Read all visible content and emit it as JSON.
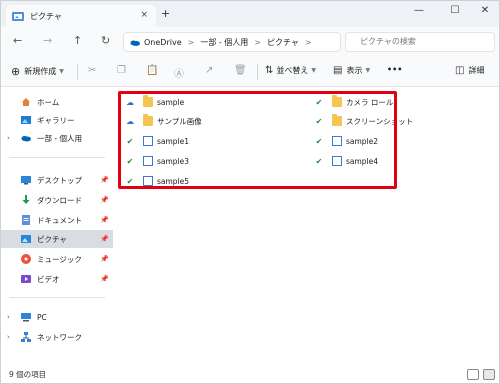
{
  "window": {
    "tab_title": "ピクチャ",
    "tab_close": "×",
    "new_tab": "+",
    "minimize": "—",
    "maximize": "☐",
    "close": "✕"
  },
  "nav": {
    "back": "←",
    "forward": "→",
    "up": "↑",
    "refresh": "↻"
  },
  "breadcrumb": [
    "OneDrive",
    ">",
    "一部 - 個人用",
    ">",
    "ピクチャ",
    ">"
  ],
  "search": {
    "placeholder": "ピクチャの検索"
  },
  "toolbar": {
    "new_label": "新規作成",
    "sort_label": "並べ替え",
    "view_label": "表示",
    "more_label": "•••",
    "details_label": "詳細"
  },
  "sidebar": {
    "items": [
      {
        "label": "ホーム"
      },
      {
        "label": "ギャラリー"
      },
      {
        "label": "一部 - 個人用"
      },
      {
        "label": "デスクトップ"
      },
      {
        "label": "ダウンロード"
      },
      {
        "label": "ドキュメント"
      },
      {
        "label": "ピクチャ"
      },
      {
        "label": "ミュージック"
      },
      {
        "label": "ビデオ"
      },
      {
        "label": "PC"
      },
      {
        "label": "ネットワーク"
      }
    ]
  },
  "files": [
    {
      "name": "sample",
      "type": "folder",
      "status": "cloud"
    },
    {
      "name": "サンプル画像",
      "type": "folder",
      "status": "cloud"
    },
    {
      "name": "sample1",
      "type": "image",
      "status": "synced"
    },
    {
      "name": "sample3",
      "type": "image",
      "status": "synced"
    },
    {
      "name": "sample5",
      "type": "image",
      "status": "synced"
    },
    {
      "name": "カメラ ロール",
      "type": "folder",
      "status": "synced"
    },
    {
      "name": "スクリーンショット",
      "type": "folder",
      "status": "synced"
    },
    {
      "name": "sample2",
      "type": "image",
      "status": "synced"
    },
    {
      "name": "sample4",
      "type": "image",
      "status": "synced"
    }
  ],
  "status": {
    "item_count": "9 個の項目"
  },
  "colors": {
    "accent": "#0067c0",
    "highlight_border": "#e00012",
    "synced": "#2e8540",
    "cloud": "#2f6fd0"
  }
}
